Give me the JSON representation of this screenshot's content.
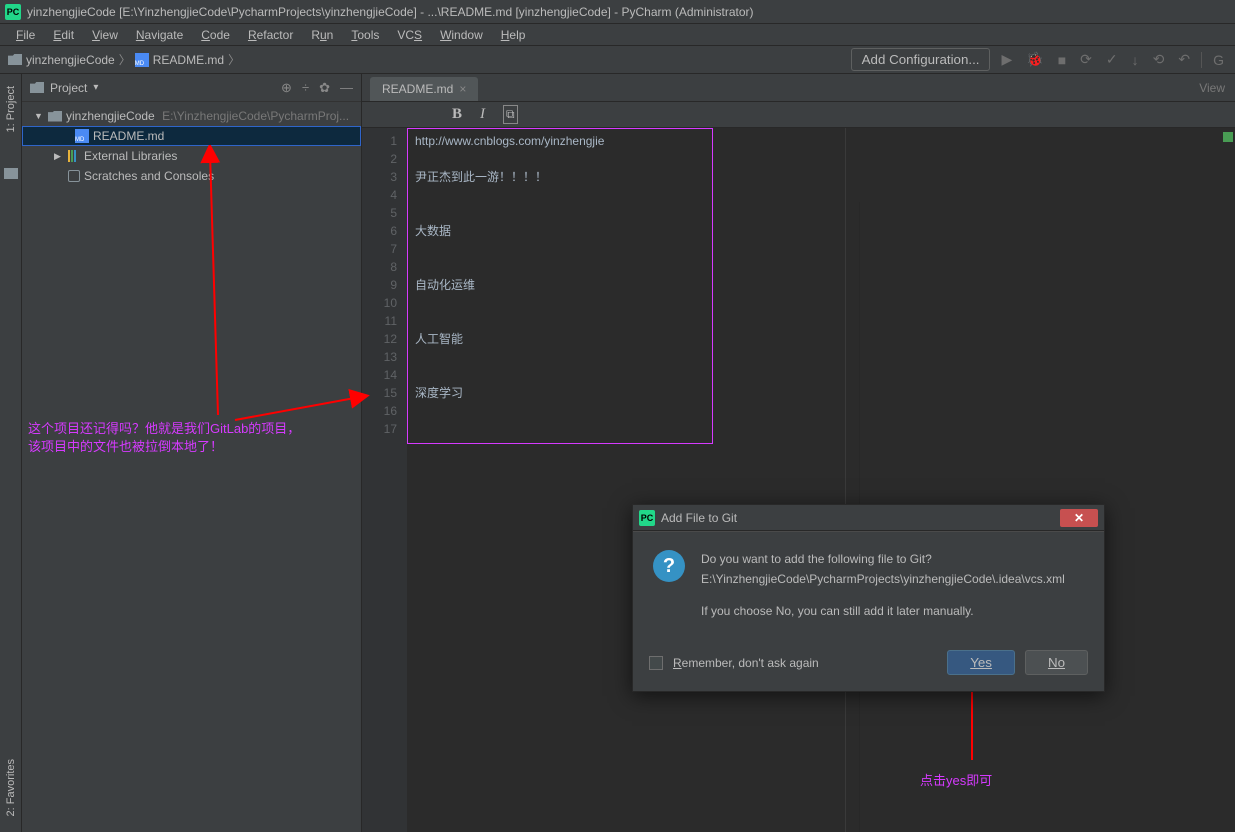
{
  "window": {
    "title": "yinzhengjieCode [E:\\YinzhengjieCode\\PycharmProjects\\yinzhengjieCode] - ...\\README.md [yinzhengjieCode] - PyCharm (Administrator)"
  },
  "menu": {
    "file": "File",
    "edit": "Edit",
    "view": "View",
    "navigate": "Navigate",
    "code": "Code",
    "refactor": "Refactor",
    "run": "Run",
    "tools": "Tools",
    "vcs": "VCS",
    "window": "Window",
    "help": "Help"
  },
  "breadcrumb": {
    "project": "yinzhengjieCode",
    "file": "README.md"
  },
  "navbar": {
    "add_config": "Add Configuration...",
    "right_text": "G"
  },
  "project_panel": {
    "title": "Project",
    "root": "yinzhengjieCode",
    "root_path": "E:\\YinzhengjieCode\\PycharmProjects\\yinzhengjieCode",
    "file1": "README.md",
    "external": "External Libraries",
    "scratches": "Scratches and Consoles"
  },
  "left_labels": {
    "project": "1: Project",
    "favorites": "2: Favorites"
  },
  "editor": {
    "tab_name": "README.md",
    "view_text": "View",
    "lines": [
      "http://www.cnblogs.com/yinzhengjie",
      "",
      "尹正杰到此一游！！！！",
      "",
      "",
      "大数据",
      "",
      "",
      "自动化运维",
      "",
      "",
      "人工智能",
      "",
      "",
      "深度学习",
      "",
      ""
    ]
  },
  "dialog": {
    "title": "Add File to Git",
    "line1": "Do you want to add the following file to Git?",
    "line2": "E:\\YinzhengjieCode\\PycharmProjects\\yinzhengjieCode\\.idea\\vcs.xml",
    "line3": "If you choose No, you can still add it later manually.",
    "remember": "Remember, don't ask again",
    "yes": "Yes",
    "no": "No"
  },
  "annotations": {
    "note1a": "这个项目还记得吗？他就是我们GitLab的项目，",
    "note1b": "该项目中的文件也被拉倒本地了！",
    "note2": "点击yes即可"
  }
}
